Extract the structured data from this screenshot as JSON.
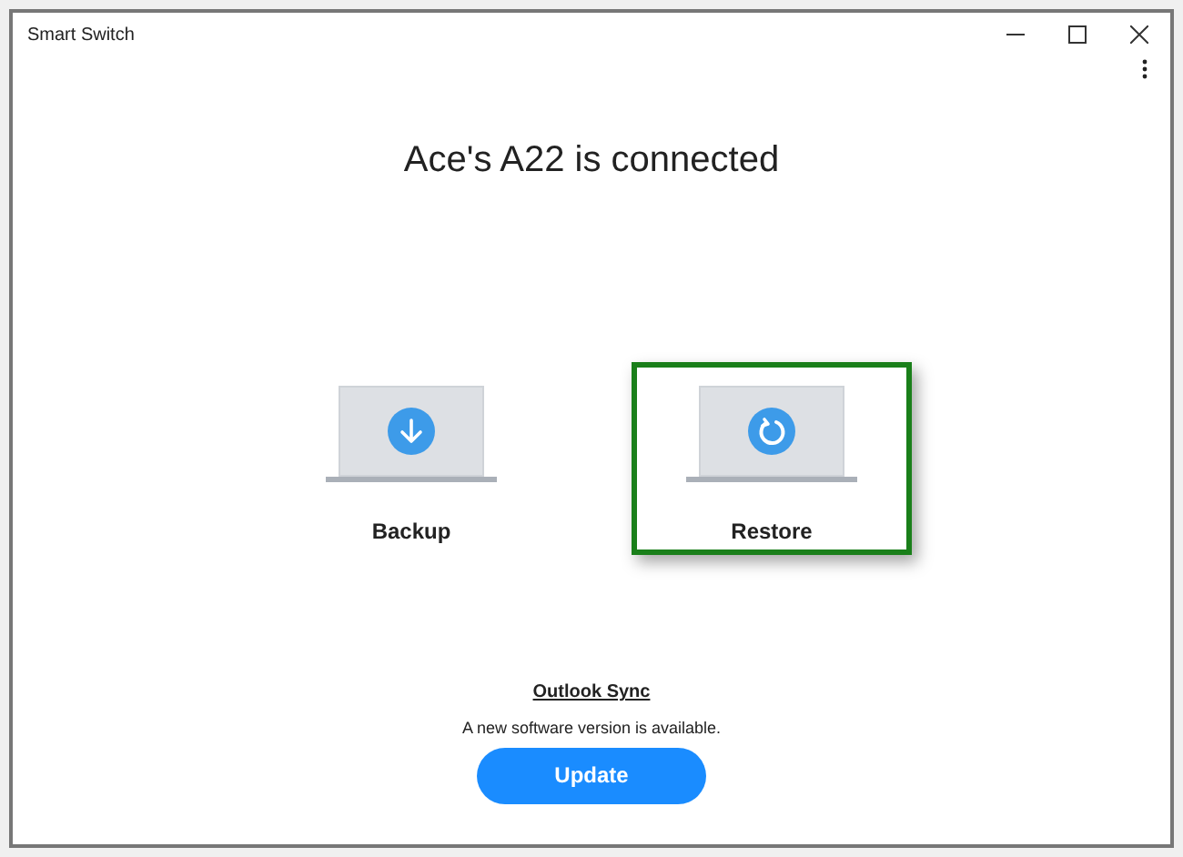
{
  "window": {
    "title": "Smart Switch"
  },
  "heading": "Ace's A22 is connected",
  "options": [
    {
      "kind": "backup",
      "label": "Backup",
      "selected": false
    },
    {
      "kind": "restore",
      "label": "Restore",
      "selected": true
    }
  ],
  "footer": {
    "link": "Outlook Sync",
    "message": "A new software version is available.",
    "button": "Update"
  }
}
